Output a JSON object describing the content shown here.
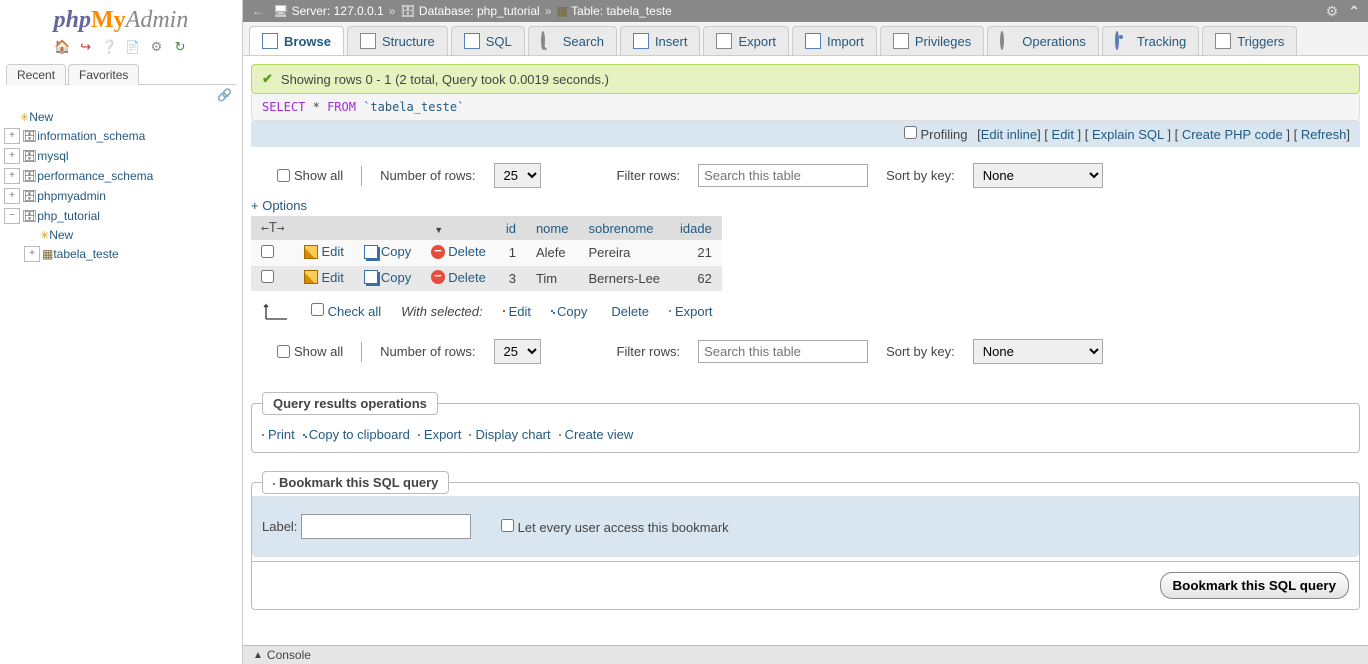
{
  "breadcrumb": {
    "server_label": "Server:",
    "server": "127.0.0.1",
    "database_label": "Database:",
    "database": "php_tutorial",
    "table_label": "Table:",
    "table": "tabela_teste"
  },
  "logo": {
    "part1": "php",
    "part2": "My",
    "part3": "Admin"
  },
  "tree_tabs": {
    "recent": "Recent",
    "favorites": "Favorites"
  },
  "tree": {
    "new": "New",
    "dbs": [
      "information_schema",
      "mysql",
      "performance_schema",
      "phpmyadmin",
      "php_tutorial"
    ],
    "php_tutorial_children": {
      "new": "New",
      "table": "tabela_teste"
    }
  },
  "tabs": {
    "browse": "Browse",
    "structure": "Structure",
    "sql": "SQL",
    "search": "Search",
    "insert": "Insert",
    "export": "Export",
    "import": "Import",
    "privileges": "Privileges",
    "operations": "Operations",
    "tracking": "Tracking",
    "triggers": "Triggers"
  },
  "success_msg": "Showing rows 0 - 1 (2 total, Query took 0.0019 seconds.)",
  "sql": {
    "select": "SELECT",
    "star": "*",
    "from": "FROM",
    "table": "`tabela_teste`"
  },
  "linkbar": {
    "profiling": "Profiling",
    "edit_inline": "Edit inline",
    "edit": "Edit",
    "explain": "Explain SQL",
    "create_php": "Create PHP code",
    "refresh": "Refresh"
  },
  "controls": {
    "show_all": "Show all",
    "num_rows": "Number of rows:",
    "rows_value": "25",
    "filter_label": "Filter rows:",
    "filter_placeholder": "Search this table",
    "sort_label": "Sort by key:",
    "sort_value": "None"
  },
  "options": "+ Options",
  "columns": {
    "id": "id",
    "nome": "nome",
    "sobrenome": "sobrenome",
    "idade": "idade"
  },
  "row_actions": {
    "edit": "Edit",
    "copy": "Copy",
    "delete": "Delete"
  },
  "rows": [
    {
      "id": "1",
      "nome": "Alefe",
      "sobrenome": "Pereira",
      "idade": "21"
    },
    {
      "id": "3",
      "nome": "Tim",
      "sobrenome": "Berners-Lee",
      "idade": "62"
    }
  ],
  "checkall": {
    "label": "Check all",
    "with_selected": "With selected:",
    "edit": "Edit",
    "copy": "Copy",
    "delete": "Delete",
    "export": "Export"
  },
  "qro": {
    "legend": "Query results operations",
    "print": "Print",
    "copy_clip": "Copy to clipboard",
    "export": "Export",
    "chart": "Display chart",
    "view": "Create view"
  },
  "bookmark": {
    "legend": "Bookmark this SQL query",
    "label": "Label:",
    "every_user": "Let every user access this bookmark",
    "button": "Bookmark this SQL query"
  },
  "console": "Console"
}
